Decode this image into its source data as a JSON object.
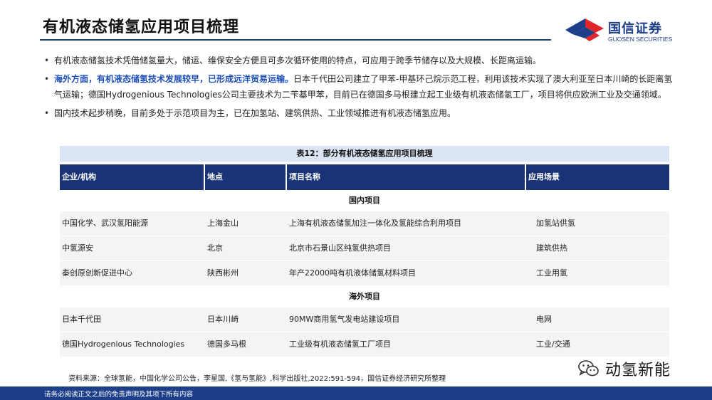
{
  "header": {
    "title": "有机液态储氢应用项目梳理",
    "logo_cn": "国信证券",
    "logo_en": "GUOSEN SECURITIES",
    "brand_color": "#1d3f8a",
    "logo_red": "#e0262a"
  },
  "bullets": [
    {
      "text": "有机液态储氢技术凭借储氢量大，储运、维保安全方便且可多次循环使用的特点，可应用于跨季节储存以及大规模、长距离运输。"
    },
    {
      "em": "海外方面，有机液态储氢技术发展较早，已形成远洋贸易运输。",
      "text": "日本千代田公司建立了甲苯-甲基环己烷示范工程，利用该技术实现了澳大利亚至日本川崎的长距离氢气运输；德国Hydrogenious Technologies公司主要技术为二苄基甲苯，目前已在德国多马根建立起工业级有机液态储氢工厂，项目将供应欧洲工业及交通领域。"
    },
    {
      "text": "国内技术起步稍晚，目前多处于示范项目为主，已在加氢站、建筑供热、工业领域推进有机液态储氢应用。"
    }
  ],
  "table": {
    "caption": "表12：部分有机液态储氢应用项目梳理",
    "headers": [
      "企业/机构",
      "地点",
      "项目名称",
      "应用场景"
    ],
    "domestic_label": "国内项目",
    "domestic_rows": [
      [
        "中国化学、武汉氢阳能源",
        "上海金山",
        "上海有机液态储氢加注一体化及氢能综合利用项目",
        "加氢站供氢"
      ],
      [
        "中氢源安",
        "北京",
        "北京市石景山区纯氢供热项目",
        "建筑供热"
      ],
      [
        "秦创原创新促进中心",
        "陕西彬州",
        "年产22000吨有机液体储氢材料项目",
        "工业用氢"
      ]
    ],
    "overseas_label": "海外项目",
    "overseas_rows": [
      [
        "日本千代田",
        "日本川崎",
        "90MW商用氢气发电站建设项目",
        "电网"
      ],
      [
        "德国Hydrogenious Technologies",
        "德国多马根",
        "工业级有机液态储氢工厂项目",
        "工业/交通"
      ]
    ]
  },
  "source": "资料来源：全球氢能，中国化学公司公告，李星国,《氢与氢能》,科学出版社,2022:591-594，国信证券经济研究所整理",
  "watermark": "动氢新能",
  "footer": "请务必阅读正文之后的免责声明及其项下所有内容"
}
